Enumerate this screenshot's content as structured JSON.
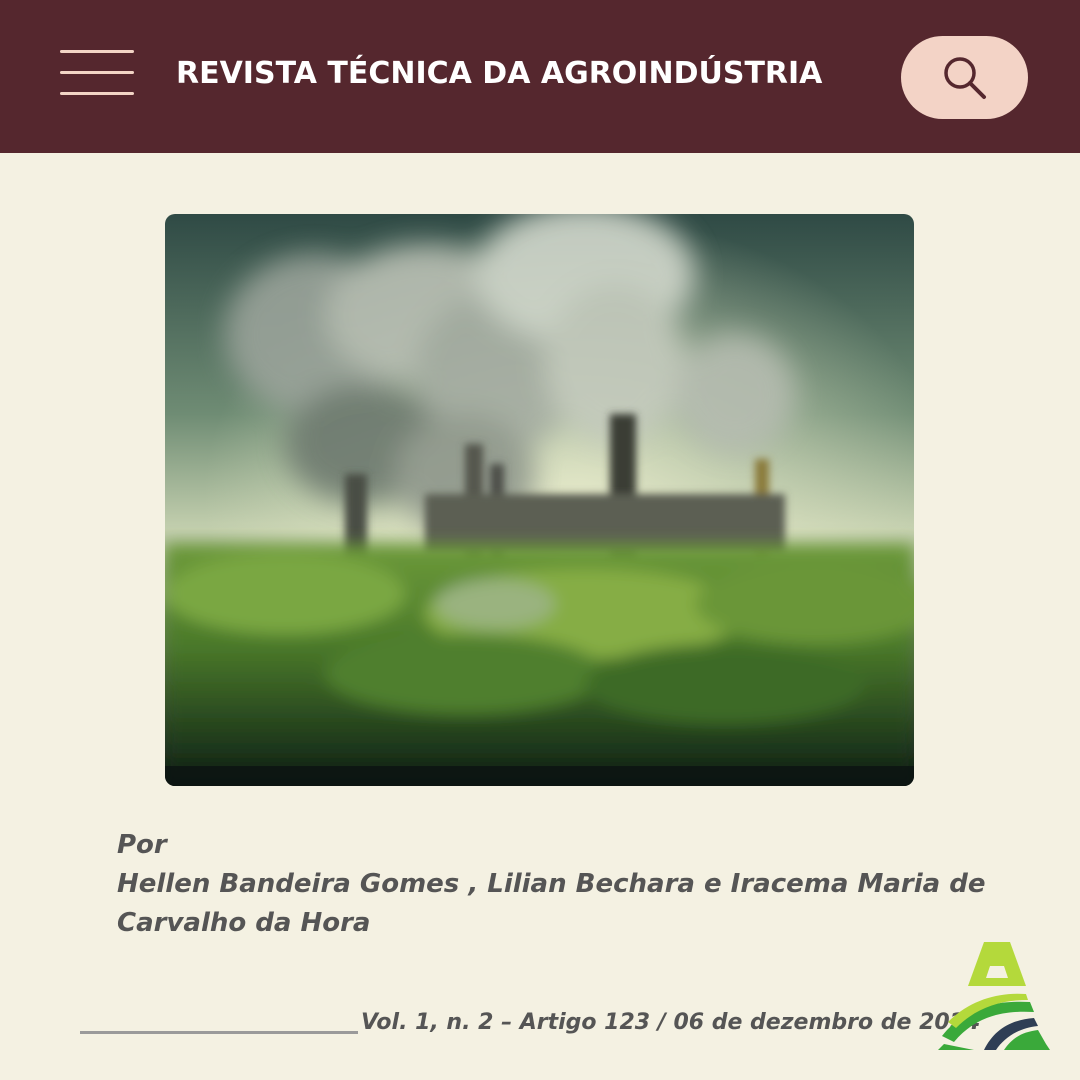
{
  "header": {
    "title": "REVISTA TÉCNICA DA AGROINDÚSTRIA",
    "menu_icon": "hamburger-menu-icon",
    "search_icon": "search-icon"
  },
  "hero_image": {
    "subject": "industrial-smokestacks-over-green-forest"
  },
  "article": {
    "by_label": "Por",
    "authors_line1": "Hellen Bandeira Gomes , Lilian Bechara e Iracema Maria de",
    "authors_line2": "Carvalho da Hora"
  },
  "footer": {
    "citation": "Vol. 1, n. 2 – Artigo 123 / 06 de dezembro de 2024",
    "logo": "agroindustria-logo"
  },
  "colors": {
    "header_bg": "#55272e",
    "page_bg": "#f4f1e2",
    "accent_pink": "#f3d3c6",
    "text_gray": "#555555",
    "logo_green_light": "#b4d93b",
    "logo_green": "#3aa93a",
    "logo_navy": "#2f3e55"
  }
}
